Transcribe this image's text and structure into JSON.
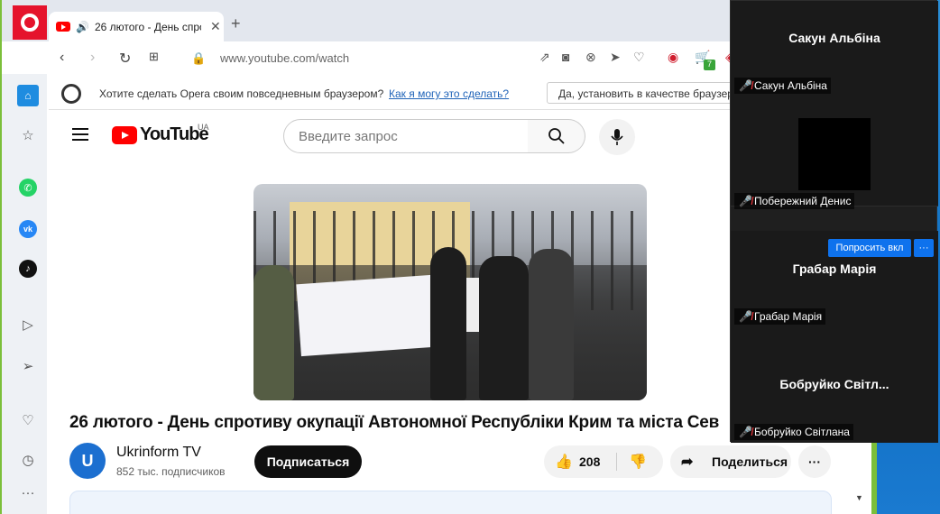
{
  "browser": {
    "tab_title": "26 лютого - День спро",
    "url": "www.youtube.com/watch",
    "badge_count": "7",
    "infobar_text": "Хотите сделать Opera своим повседневным браузером?",
    "infobar_link": "Как я могу это сделать?",
    "infobar_button": "Да, установить в качестве браузера"
  },
  "youtube": {
    "logo_text": "YouTube",
    "region": "UA",
    "search_placeholder": "Введите запрос",
    "video_title": "26 лютого - День спротиву окупації Автономної Республіки Крим та міста Сев",
    "channel_name": "Ukrinform TV",
    "channel_subs": "852 тыс. подписчиков",
    "subscribe_label": "Подписаться",
    "like_count": "208",
    "share_label": "Поделиться"
  },
  "zoom": {
    "participants": [
      {
        "display": "Сакун Альбіна",
        "label": "Сакун Альбіна"
      },
      {
        "display": "",
        "label": "Побережний Денис"
      },
      {
        "display": "Грабар Марія",
        "label": "Грабар Марія",
        "ask_button": "Попросить вкл",
        "more_button": "···"
      },
      {
        "display": "Бобруйко  Світл...",
        "label": "Бобруйко Світлана"
      }
    ]
  },
  "colors": {
    "opera_red": "#e5132c",
    "youtube_red": "#ff0000",
    "zoom_blue": "#0e72ed",
    "mic_off_red": "#e8343a"
  }
}
